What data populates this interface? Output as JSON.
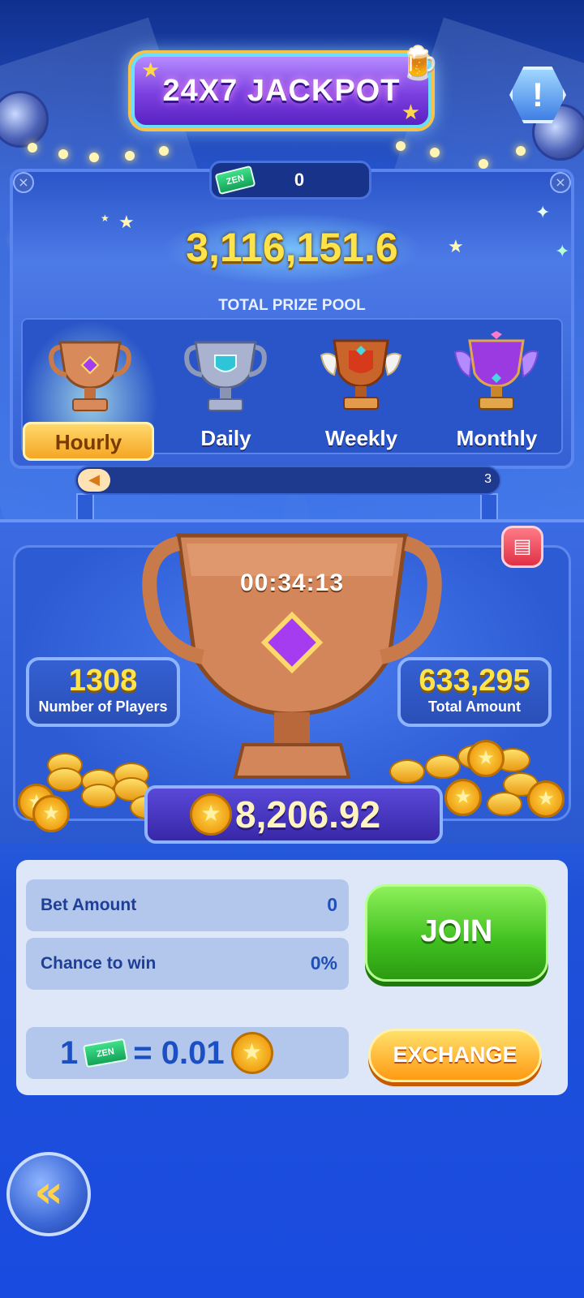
{
  "header": {
    "title": "24X7 JACKPOT",
    "info_icon": "exclamation-icon"
  },
  "balance": {
    "ticket_label": "ZEN",
    "value": "0"
  },
  "prize_pool": {
    "value": "3,116,151.6",
    "label": "TOTAL PRIZE POOL"
  },
  "tabs": [
    {
      "label": "Hourly",
      "active": true
    },
    {
      "label": "Daily",
      "active": false
    },
    {
      "label": "Weekly",
      "active": false
    },
    {
      "label": "Monthly",
      "active": false
    }
  ],
  "ticker": {
    "icon": "megaphone-icon",
    "trailing": "3"
  },
  "jackpot": {
    "timer": "00:34:13",
    "players_value": "1308",
    "players_label": "Number of Players",
    "total_value": "633,295",
    "total_label": "Total Amount",
    "prize": "8,206.92"
  },
  "bet": {
    "bet_label": "Bet Amount",
    "bet_value": "0",
    "chance_label": "Chance to win",
    "chance_value": "0%",
    "rate_left": "1",
    "rate_ticket": "ZEN",
    "rate_right": "= 0.01"
  },
  "buttons": {
    "join": "JOIN",
    "exchange": "EXCHANGE"
  },
  "colors": {
    "accent_gold": "#ffe34a",
    "join_green": "#3fbf1f",
    "exchange_orange": "#ff9a14",
    "bg_blue": "#2a5bd6"
  }
}
